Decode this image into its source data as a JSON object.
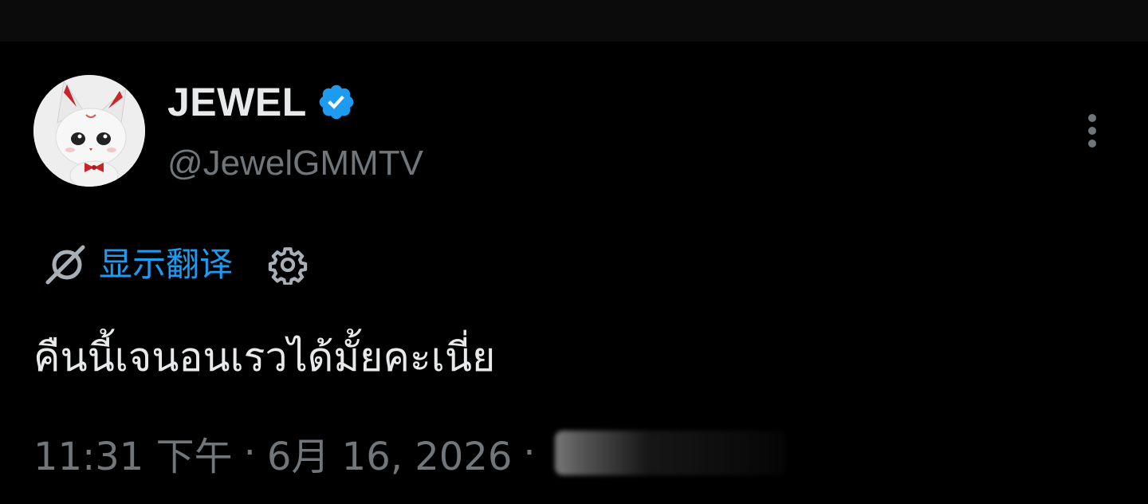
{
  "tweet": {
    "author": {
      "display_name": "JEWEL",
      "handle": "@JewelGMMTV",
      "verified": true,
      "verified_color": "#1d9bf0",
      "avatar_icon": "white-fox-plush-avatar"
    },
    "translate": {
      "label": "显示翻译",
      "icon": "translate-slash-icon",
      "settings_icon": "gear-icon",
      "color": "#1d9bf0"
    },
    "text": "คืนนี้เจนอนเรวได้มั้ยคะเนี่ย",
    "meta": {
      "time": "11:31 下午",
      "separator": "·",
      "date": "6月 16, 2026"
    },
    "more_icon": "more-vertical-icon"
  }
}
